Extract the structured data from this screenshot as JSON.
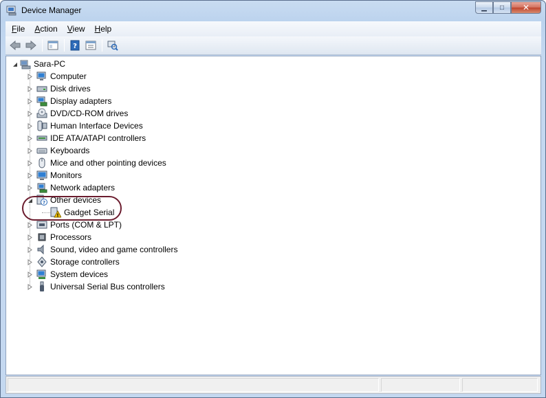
{
  "window": {
    "title": "Device Manager",
    "minimize_glyph": "▁",
    "maximize_glyph": "□",
    "close_glyph": "✕"
  },
  "menu": [
    {
      "label": "File",
      "accel": "F",
      "rest": "ile"
    },
    {
      "label": "Action",
      "accel": "A",
      "rest": "ction"
    },
    {
      "label": "View",
      "accel": "V",
      "rest": "iew"
    },
    {
      "label": "Help",
      "accel": "H",
      "rest": "elp"
    }
  ],
  "toolbar": {
    "buttons": [
      "back-icon",
      "forward-icon",
      "show-hide-console-tree-icon",
      "help-icon",
      "properties-icon",
      "scan-hardware-icon"
    ]
  },
  "tree": {
    "root": {
      "label": "Sara-PC",
      "icon": "computer-root-icon",
      "expanded": true
    },
    "items": [
      {
        "label": "Computer",
        "icon": "computer-icon"
      },
      {
        "label": "Disk drives",
        "icon": "disk-drive-icon"
      },
      {
        "label": "Display adapters",
        "icon": "display-adapter-icon"
      },
      {
        "label": "DVD/CD-ROM drives",
        "icon": "dvd-drive-icon"
      },
      {
        "label": "Human Interface Devices",
        "icon": "hid-icon"
      },
      {
        "label": "IDE ATA/ATAPI controllers",
        "icon": "ide-controller-icon"
      },
      {
        "label": "Keyboards",
        "icon": "keyboard-icon"
      },
      {
        "label": "Mice and other pointing devices",
        "icon": "mouse-icon"
      },
      {
        "label": "Monitors",
        "icon": "monitor-icon"
      },
      {
        "label": "Network adapters",
        "icon": "network-adapter-icon"
      },
      {
        "label": "Other devices",
        "icon": "other-devices-icon",
        "expanded": true,
        "children": [
          {
            "label": "Gadget Serial",
            "icon": "warning-device-icon"
          }
        ]
      },
      {
        "label": "Ports (COM & LPT)",
        "icon": "port-icon"
      },
      {
        "label": "Processors",
        "icon": "processor-icon"
      },
      {
        "label": "Sound, video and game controllers",
        "icon": "sound-icon"
      },
      {
        "label": "Storage controllers",
        "icon": "storage-controller-icon"
      },
      {
        "label": "System devices",
        "icon": "system-devices-icon"
      },
      {
        "label": "Universal Serial Bus controllers",
        "icon": "usb-icon"
      }
    ]
  },
  "colors": {
    "highlight_ring": "#6b1c2e",
    "warning": "#f2c200"
  }
}
